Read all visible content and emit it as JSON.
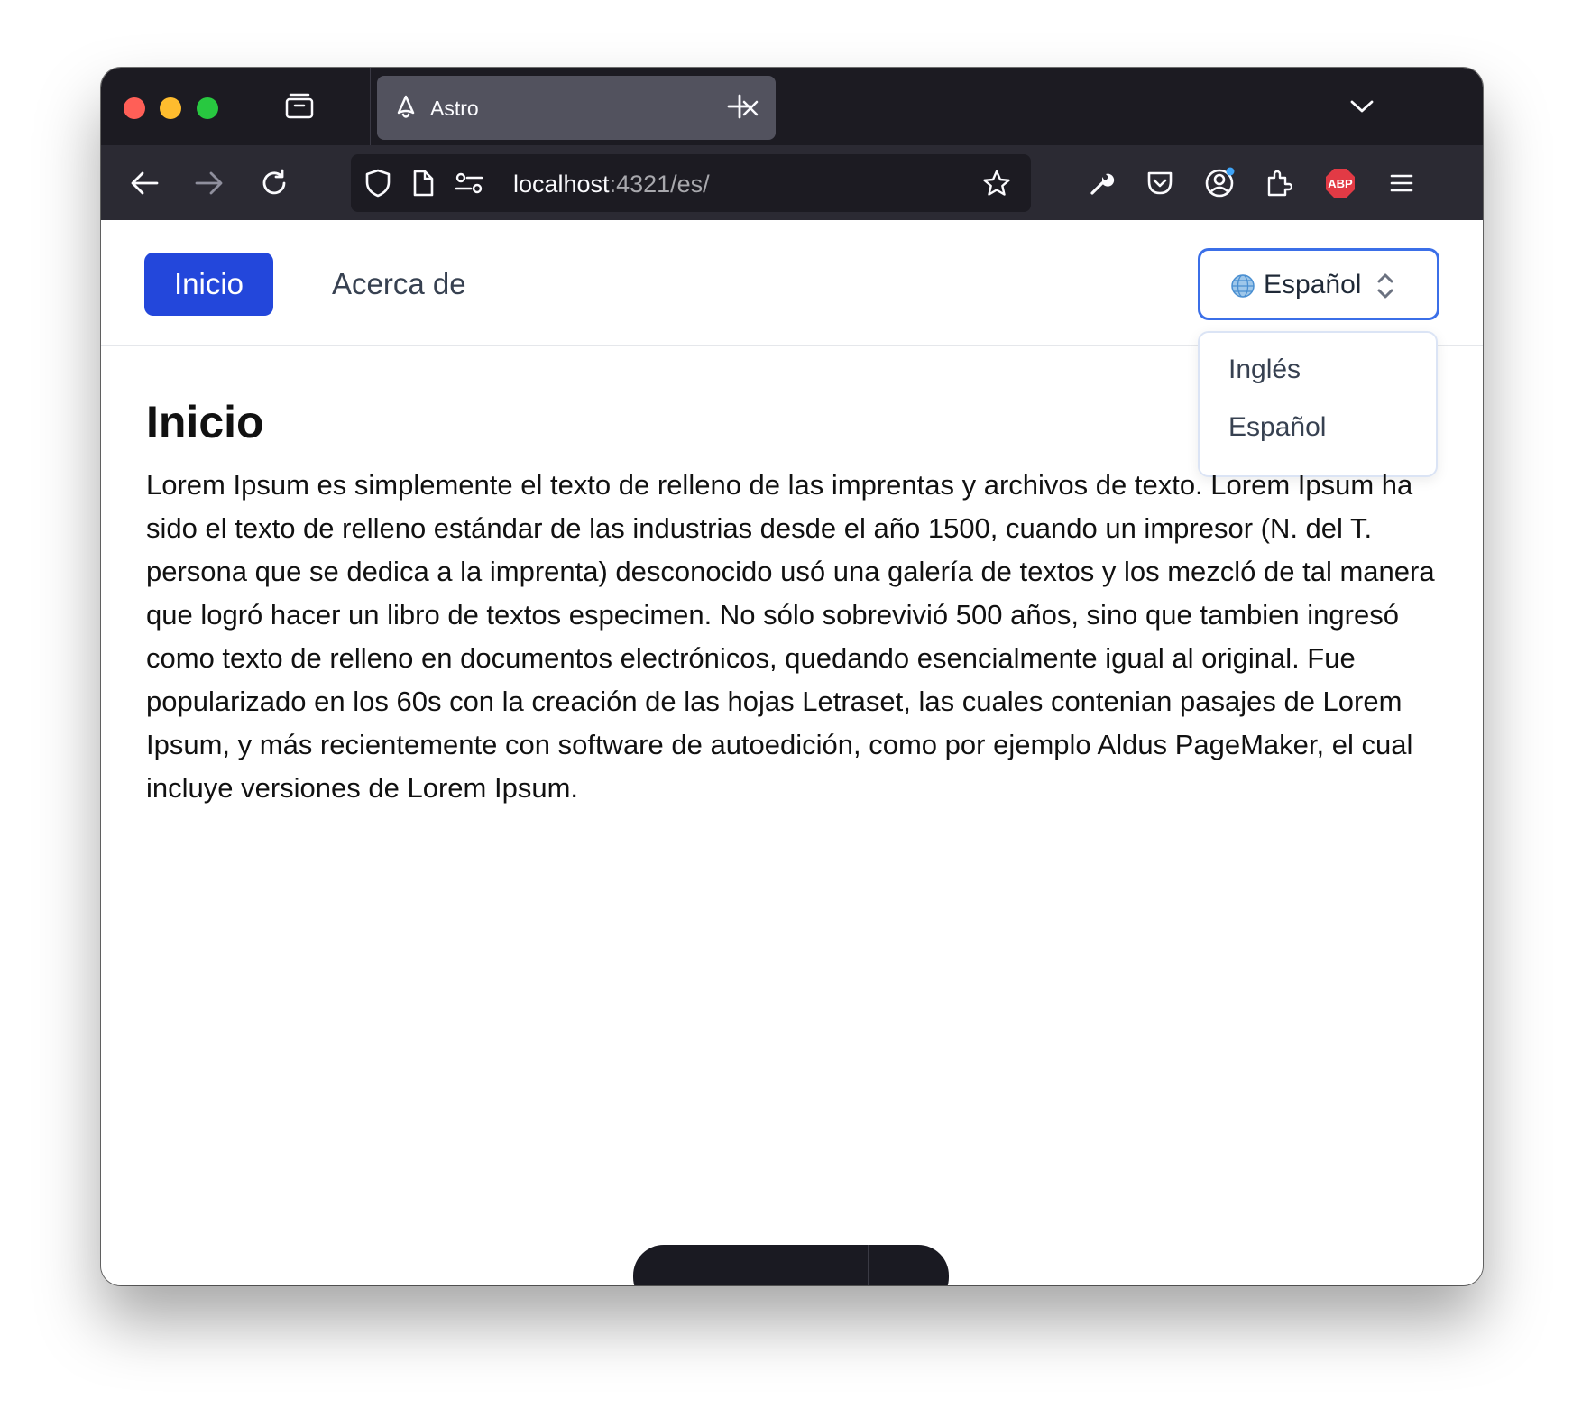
{
  "browser": {
    "tab": {
      "title": "Astro"
    },
    "url": {
      "host": "localhost",
      "rest": ":4321/es/"
    },
    "extension_badge": "ABP"
  },
  "nav": {
    "home_label": "Inicio",
    "about_label": "Acerca de"
  },
  "language_select": {
    "selected": "Español",
    "options": [
      "Inglés",
      "Español"
    ]
  },
  "content": {
    "heading": "Inicio",
    "paragraph": "Lorem Ipsum es simplemente el texto de relleno de las imprentas y archivos de texto. Lorem Ipsum ha sido el texto de relleno estándar de las industrias desde el año 1500, cuando un impresor (N. del T. persona que se dedica a la imprenta) desconocido usó una galería de textos y los mezcló de tal manera que logró hacer un libro de textos especimen. No sólo sobrevivió 500 años, sino que tambien ingresó como texto de relleno en documentos electrónicos, quedando esencialmente igual al original. Fue popularizado en los 60s con la creación de las hojas Letraset, las cuales contenian pasajes de Lorem Ipsum, y más recientemente con software de autoedición, como por ejemplo Aldus PageMaker, el cual incluye versiones de Lorem Ipsum."
  },
  "icons": [
    "close-window",
    "minimize-window",
    "zoom-window",
    "tab-overview-icon",
    "astro-logo-icon",
    "close-tab-icon",
    "new-tab-icon",
    "tab-list-chevron-icon",
    "back-arrow-icon",
    "forward-arrow-icon",
    "reload-icon",
    "shield-icon",
    "page-icon",
    "site-permissions-icon",
    "bookmark-star-icon",
    "wrench-icon",
    "pocket-icon",
    "account-icon",
    "extensions-icon",
    "adblock-icon",
    "menu-icon",
    "globe-icon",
    "chevron-updown-icon"
  ],
  "colors": {
    "primary_button": "#2347db",
    "select_border": "#3b6fe8",
    "browser_tabstrip": "#1c1b22",
    "browser_toolbar": "#2b2a33"
  }
}
